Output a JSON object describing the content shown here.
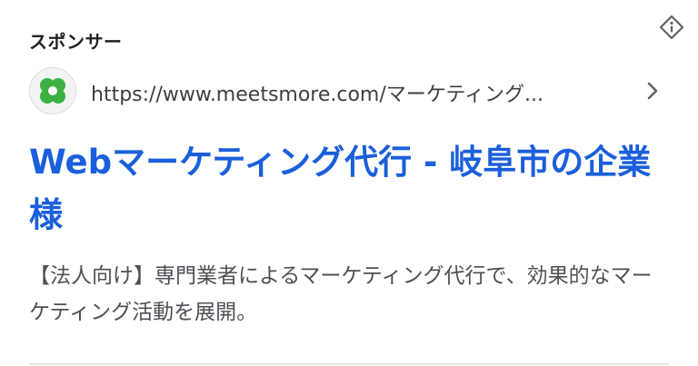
{
  "ad": {
    "sponsor_label": "スポンサー",
    "url": "https://www.meetsmore.com/マーケティング...",
    "title": "Webマーケティング代行 - 岐阜市の企業様",
    "description": "【法人向け】専門業者によるマーケティング代行で、効果的なマーケティング活動を展開。"
  },
  "icons": {
    "info": "ad-info-icon",
    "favicon": "meetsmore-favicon",
    "chevron": "chevron-right-icon"
  },
  "colors": {
    "title": "#1a5fdb",
    "favicon_green": "#3cb043",
    "text": "#202124",
    "muted": "#4d5156"
  }
}
